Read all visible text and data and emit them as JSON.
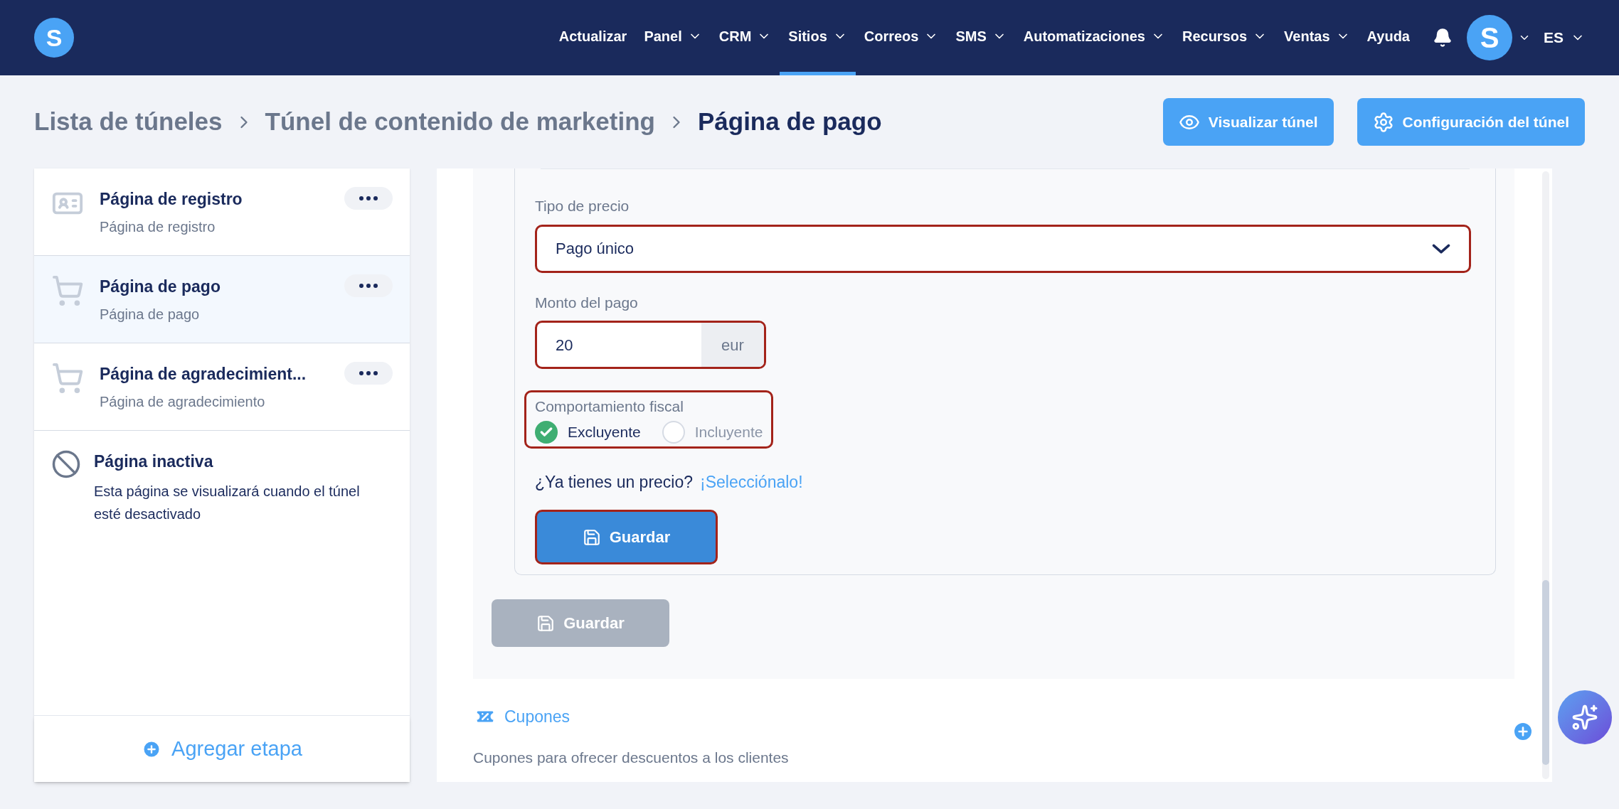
{
  "navbar": {
    "logo": "S",
    "items": [
      {
        "label": "Actualizar",
        "has_menu": false,
        "selected": false
      },
      {
        "label": "Panel",
        "has_menu": true,
        "selected": false
      },
      {
        "label": "CRM",
        "has_menu": true,
        "selected": false
      },
      {
        "label": "Sitios",
        "has_menu": true,
        "selected": true
      },
      {
        "label": "Correos",
        "has_menu": true,
        "selected": false
      },
      {
        "label": "SMS",
        "has_menu": true,
        "selected": false
      },
      {
        "label": "Automatizaciones",
        "has_menu": true,
        "selected": false
      },
      {
        "label": "Recursos",
        "has_menu": true,
        "selected": false
      },
      {
        "label": "Ventas",
        "has_menu": true,
        "selected": false
      },
      {
        "label": "Ayuda",
        "has_menu": false,
        "selected": false
      }
    ],
    "avatar": "S",
    "language": "ES"
  },
  "breadcrumb": [
    "Lista de túneles",
    "Túnel de contenido de marketing",
    "Página de pago"
  ],
  "header_buttons": [
    {
      "kind": "preview",
      "label": "Visualizar túnel"
    },
    {
      "kind": "settings",
      "label": "Configuración del túnel"
    }
  ],
  "sidebar": {
    "steps": [
      {
        "kind": "form",
        "title": "Página de registro",
        "subtitle": "Página de registro",
        "selected": false
      },
      {
        "kind": "cart",
        "title": "Página de pago",
        "subtitle": "Página de pago",
        "selected": true
      },
      {
        "kind": "cart-check",
        "title": "Página de agradecimient...",
        "subtitle": "Página de agradecimiento",
        "selected": false
      }
    ],
    "inactive": {
      "title": "Página inactiva",
      "text": "Esta página se visualizará cuando el túnel esté desactivado"
    },
    "add_step": "Agregar etapa"
  },
  "price_form": {
    "price_type": {
      "label": "Tipo de precio",
      "value": "Pago único",
      "highlighted": true
    },
    "amount": {
      "label": "Monto del pago",
      "value": "20",
      "currency": "eur",
      "highlighted": true
    },
    "tax": {
      "label": "Comportamiento fiscal",
      "highlighted": true,
      "options": [
        {
          "label": "Excluyente",
          "selected": true
        },
        {
          "label": "Incluyente",
          "selected": false
        }
      ]
    },
    "existing_price": {
      "question": "¿Ya tienes un precio?",
      "link": "¡Selecciónalo!"
    },
    "save": {
      "label": "Guardar",
      "highlighted": true
    }
  },
  "save_button": {
    "label": "Guardar",
    "disabled": true
  },
  "coupons": {
    "title": "Cupones",
    "description": "Cupones para ofrecer descuentos a los clientes"
  }
}
